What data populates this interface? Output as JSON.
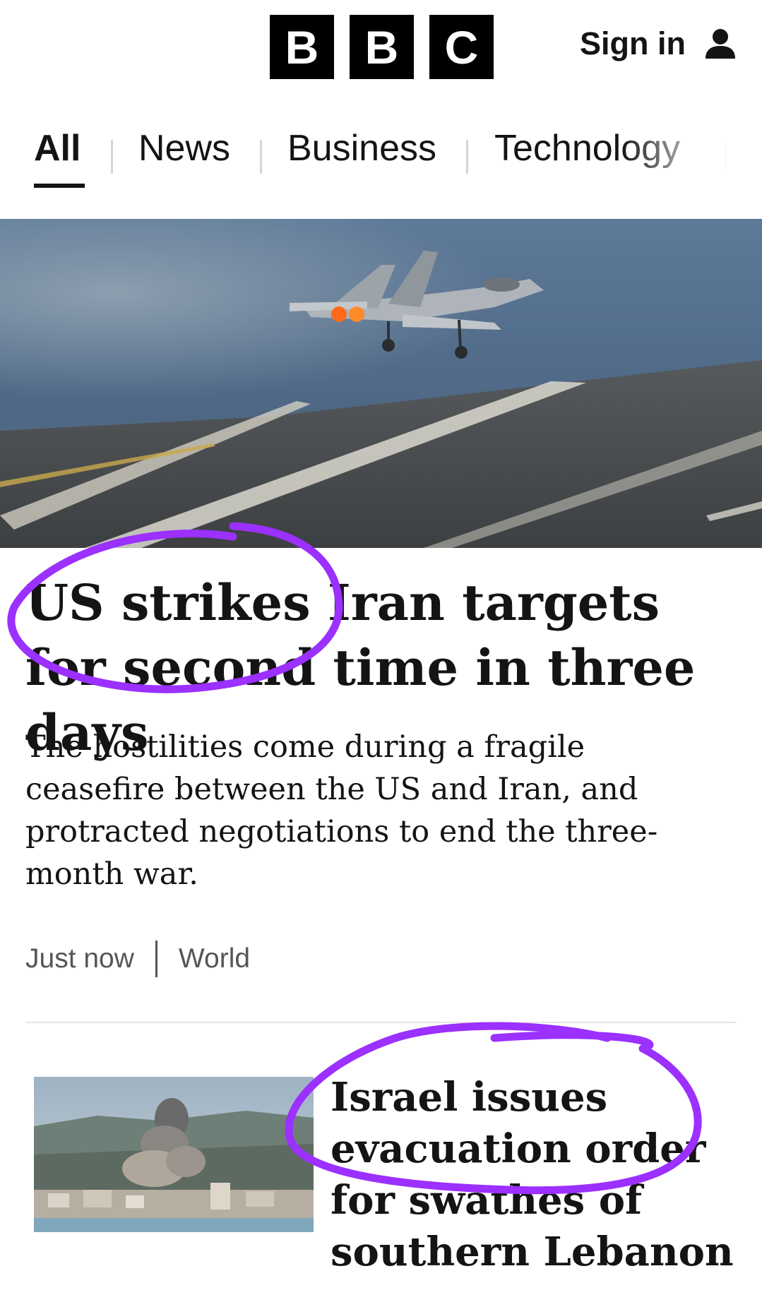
{
  "header": {
    "logo_letters": [
      "B",
      "B",
      "C"
    ],
    "signin_label": "Sign in"
  },
  "nav": {
    "tabs": [
      {
        "label": "All",
        "active": true
      },
      {
        "label": "News",
        "active": false
      },
      {
        "label": "Business",
        "active": false
      },
      {
        "label": "Technology",
        "active": false
      }
    ]
  },
  "lead_story": {
    "headline": "US strikes Iran targets for second time in three days",
    "summary": "The hostilities come during a fragile ceasefire between the US and Iran, and protracted negotiations to end the three-month war.",
    "timestamp": "Just now",
    "section": "World"
  },
  "second_story": {
    "headline": "Israel issues evacuation order for swathes of southern Lebanon"
  },
  "colors": {
    "text": "#141414",
    "meta": "#545658",
    "annotation_ink": "#9b30ff"
  },
  "icons": {
    "signin": "user-icon"
  }
}
